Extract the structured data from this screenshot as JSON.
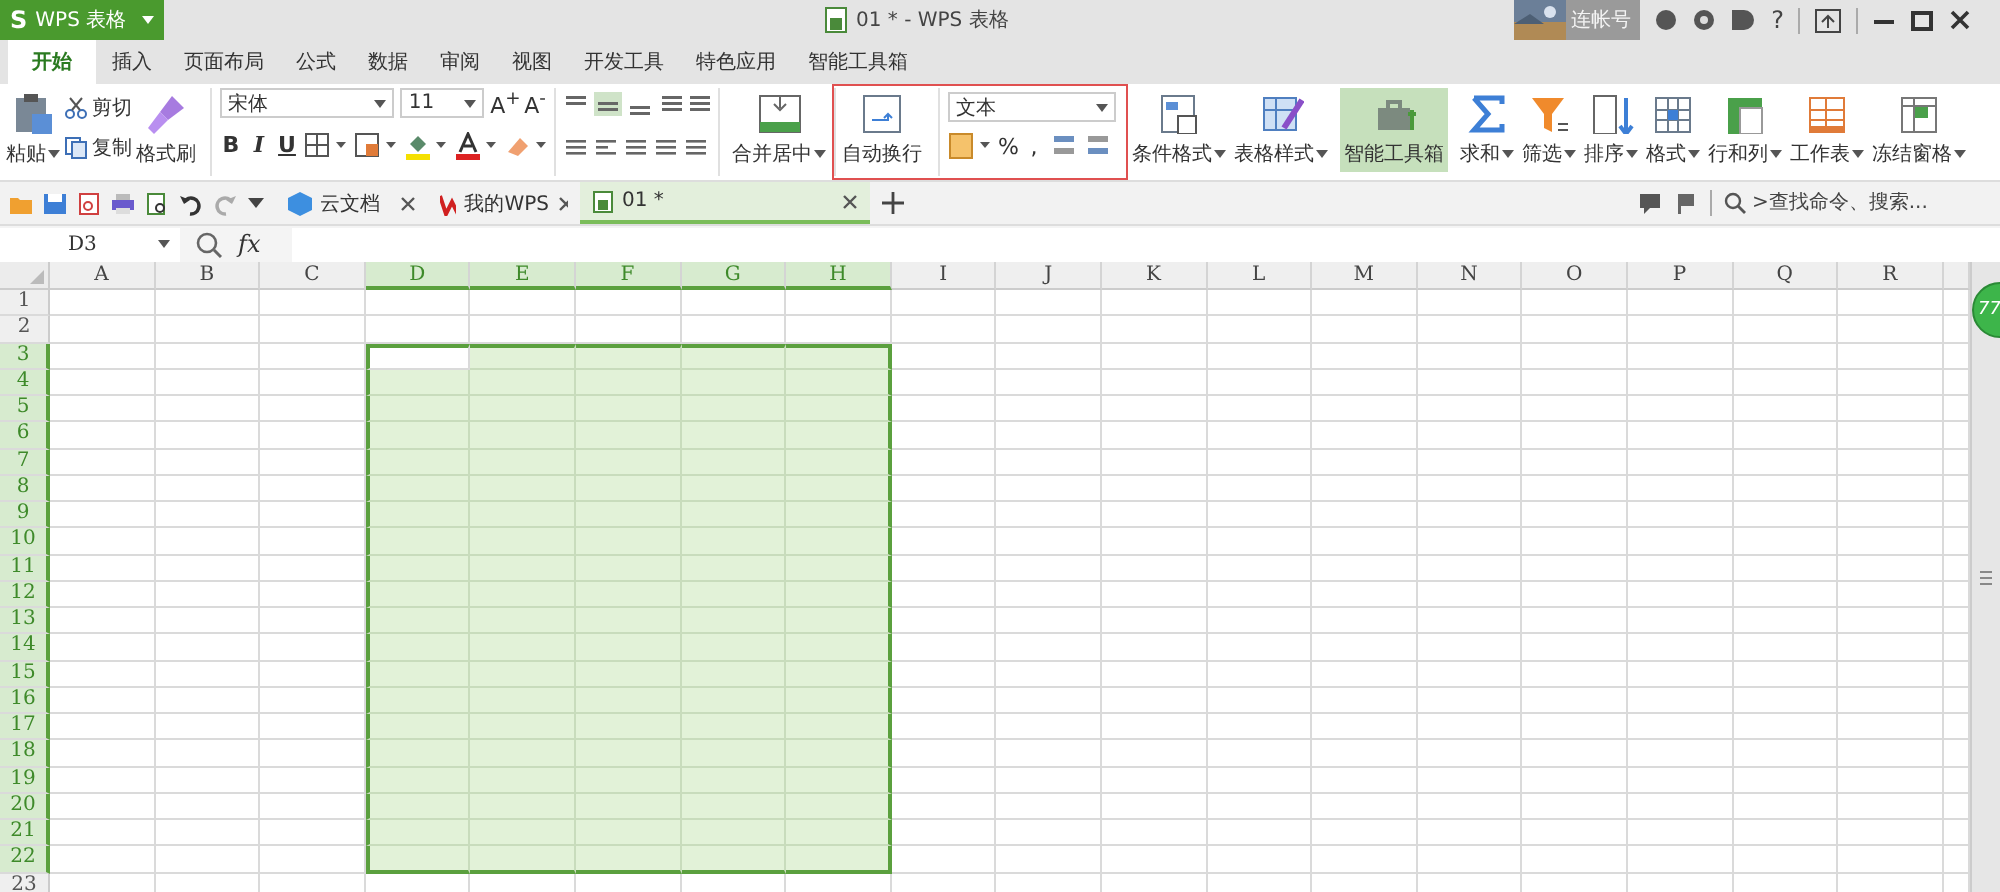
{
  "app_menu": {
    "logo": "S",
    "label": "WPS 表格"
  },
  "window": {
    "title": "01 * - WPS 表格"
  },
  "account": {
    "name": "连帐号"
  },
  "help": "?",
  "menu_tabs": [
    {
      "label": "开始",
      "selected": true
    },
    {
      "label": "插入",
      "selected": false
    },
    {
      "label": "页面布局",
      "selected": false
    },
    {
      "label": "公式",
      "selected": false
    },
    {
      "label": "数据",
      "selected": false
    },
    {
      "label": "审阅",
      "selected": false
    },
    {
      "label": "视图",
      "selected": false
    },
    {
      "label": "开发工具",
      "selected": false
    },
    {
      "label": "特色应用",
      "selected": false
    },
    {
      "label": "智能工具箱",
      "selected": false
    }
  ],
  "ribbon": {
    "paste": "粘贴",
    "cut": "剪切",
    "copy": "复制",
    "format_painter": "格式刷",
    "font_name": "宋体",
    "font_size": "11",
    "grow_font": "A$^{+}$",
    "shrink_font": "A$^{-}$",
    "styles": [
      "B",
      "I",
      "U"
    ],
    "merge": "合并居中",
    "wrap": "自动换行",
    "number_format": "文本",
    "percent": "%",
    "comma": ",",
    "large_buttons": [
      {
        "label": "条件格式",
        "dropdown": true,
        "selected": false
      },
      {
        "label": "表格样式",
        "dropdown": true,
        "selected": false
      },
      {
        "label": "智能工具箱",
        "dropdown": false,
        "selected": true
      },
      {
        "label": "求和",
        "dropdown": true,
        "selected": false
      },
      {
        "label": "筛选",
        "dropdown": true,
        "selected": false
      },
      {
        "label": "排序",
        "dropdown": true,
        "selected": false
      },
      {
        "label": "格式",
        "dropdown": true,
        "selected": false
      },
      {
        "label": "行和列",
        "dropdown": true,
        "selected": false
      },
      {
        "label": "工作表",
        "dropdown": true,
        "selected": false
      },
      {
        "label": "冻结窗格",
        "dropdown": true,
        "selected": false
      }
    ]
  },
  "doc_tabs": [
    {
      "label": "云文档",
      "selected": false
    },
    {
      "label": "我的WPS",
      "selected": false
    },
    {
      "label": "01 *",
      "selected": true
    }
  ],
  "search": {
    "placeholder": ">查找命令、搜索..."
  },
  "formula_bar": {
    "name_box": "D3",
    "function_label": "fx"
  },
  "sheet": {
    "columns": [
      {
        "label": "A",
        "selected": false
      },
      {
        "label": "B",
        "selected": false
      },
      {
        "label": "C",
        "selected": false
      },
      {
        "label": "D",
        "selected": true
      },
      {
        "label": "E",
        "selected": true
      },
      {
        "label": "F",
        "selected": true
      },
      {
        "label": "G",
        "selected": true
      },
      {
        "label": "H",
        "selected": true
      },
      {
        "label": "I",
        "selected": false
      },
      {
        "label": "J",
        "selected": false
      },
      {
        "label": "K",
        "selected": false
      },
      {
        "label": "L",
        "selected": false
      },
      {
        "label": "M",
        "selected": false
      },
      {
        "label": "N",
        "selected": false
      },
      {
        "label": "O",
        "selected": false
      },
      {
        "label": "P",
        "selected": false
      },
      {
        "label": "Q",
        "selected": false
      },
      {
        "label": "R",
        "selected": false
      }
    ],
    "rows": [
      {
        "label": "1",
        "selected": false
      },
      {
        "label": "2",
        "selected": false
      },
      {
        "label": "3",
        "selected": true
      },
      {
        "label": "4",
        "selected": true
      },
      {
        "label": "5",
        "selected": true
      },
      {
        "label": "6",
        "selected": true
      },
      {
        "label": "7",
        "selected": true
      },
      {
        "label": "8",
        "selected": true
      },
      {
        "label": "9",
        "selected": true
      },
      {
        "label": "10",
        "selected": true
      },
      {
        "label": "11",
        "selected": true
      },
      {
        "label": "12",
        "selected": true
      },
      {
        "label": "13",
        "selected": true
      },
      {
        "label": "14",
        "selected": true
      },
      {
        "label": "15",
        "selected": true
      },
      {
        "label": "16",
        "selected": true
      },
      {
        "label": "17",
        "selected": true
      },
      {
        "label": "18",
        "selected": true
      },
      {
        "label": "19",
        "selected": true
      },
      {
        "label": "20",
        "selected": true
      },
      {
        "label": "21",
        "selected": true
      },
      {
        "label": "22",
        "selected": true
      },
      {
        "label": "23",
        "selected": false
      }
    ]
  },
  "badge": {
    "count": "77"
  }
}
